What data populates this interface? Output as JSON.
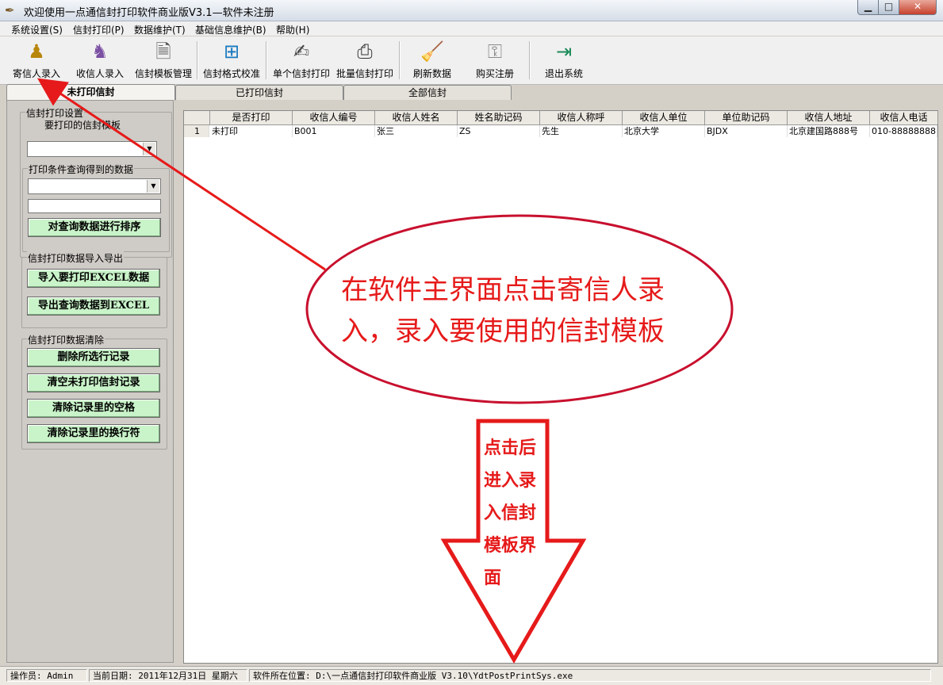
{
  "window": {
    "title": "欢迎使用一点通信封打印软件商业版V3.1—软件未注册",
    "controls": {
      "minimize": "▁",
      "maximize": "□",
      "close": "✕"
    }
  },
  "menu": [
    "系统设置(S)",
    "信封打印(P)",
    "数据维护(T)",
    "基础信息维护(B)",
    "帮助(H)"
  ],
  "toolbar": [
    {
      "label": "寄信人录入",
      "icon": "sender-person-icon"
    },
    {
      "label": "收信人录入",
      "icon": "receiver-person-icon"
    },
    {
      "label": "信封模板管理",
      "icon": "template-doc-icon"
    },
    {
      "label": "信封格式校准",
      "icon": "calibrate-icon"
    },
    {
      "label": "单个信封打印",
      "icon": "pen-print-icon"
    },
    {
      "label": "批量信封打印",
      "icon": "printer-icon"
    },
    {
      "label": "刷新数据",
      "icon": "broom-icon"
    },
    {
      "label": "购买注册",
      "icon": "keys-icon"
    },
    {
      "label": "退出系统",
      "icon": "exit-door-icon"
    }
  ],
  "tabs": [
    "未打印信封",
    "已打印信封",
    "全部信封"
  ],
  "left_panel": {
    "group1": {
      "title": "信封打印设置",
      "sub_label": "要打印的信封模板"
    },
    "group2": {
      "title": "打印条件查询得到的数据",
      "sort_button": "对查询数据进行排序"
    },
    "group3": {
      "title": "信封打印数据导入导出",
      "import_button": "导入要打印EXCEL数据",
      "export_button": "导出查询数据到EXCEL"
    },
    "group4": {
      "title": "信封打印数据清除",
      "buttons": [
        "删除所选行记录",
        "清空未打印信封记录",
        "清除记录里的空格",
        "清除记录里的换行符"
      ]
    }
  },
  "grid": {
    "headers": [
      "",
      "是否打印",
      "收信人编号",
      "收信人姓名",
      "姓名助记码",
      "收信人称呼",
      "收信人单位",
      "单位助记码",
      "收信人地址",
      "收信人电话"
    ],
    "rows": [
      [
        "1",
        "未打印",
        "B001",
        "张三",
        "ZS",
        "先生",
        "北京大学",
        "BJDX",
        "北京建国路888号",
        "010-88888888"
      ]
    ]
  },
  "status_bar": [
    "操作员: Admin",
    "当前日期: 2011年12月31日 星期六",
    "软件所在位置: D:\\一点通信封打印软件商业版 V3.10\\YdtPostPrintSys.exe"
  ],
  "annotation": {
    "ellipse_text_line1": "在软件主界面点击寄信人录",
    "ellipse_text_line2": "入，录入要使用的信封模板",
    "arrow_text": [
      "点击后",
      "进入录",
      "入信封",
      "模板界",
      "面"
    ],
    "color": "#e61a1a"
  }
}
